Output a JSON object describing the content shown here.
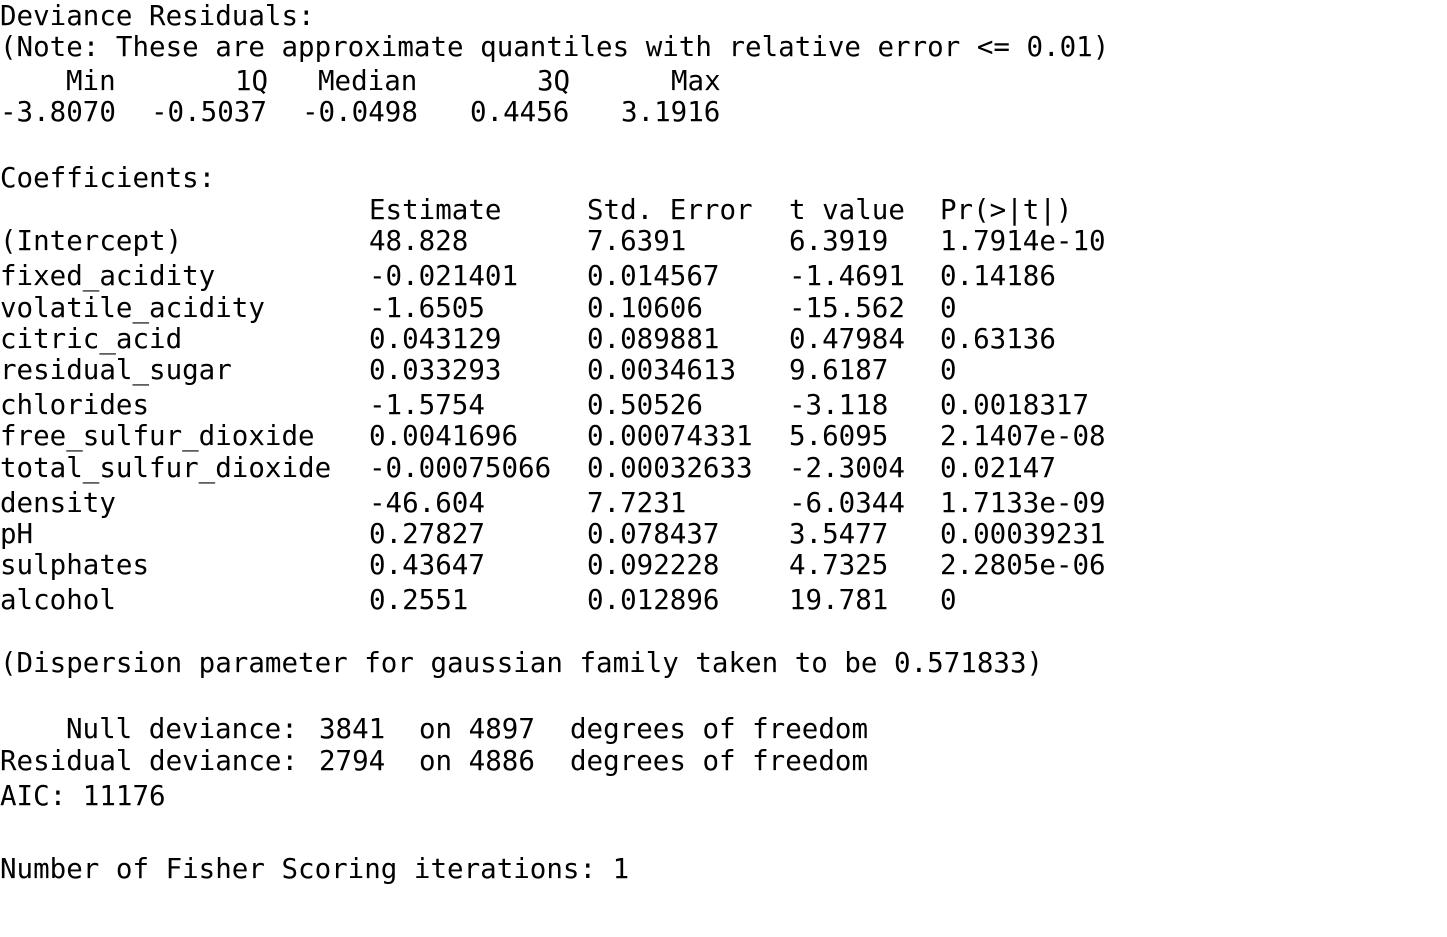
{
  "deviance_residuals": {
    "title": "Deviance Residuals:",
    "note": "(Note: These are approximate quantiles with relative error <= 0.01)",
    "headers": [
      "Min",
      "1Q",
      "Median",
      "3Q",
      "Max"
    ],
    "values": [
      "-3.8070",
      "-0.5037",
      "-0.0498",
      "0.4456",
      "3.1916"
    ]
  },
  "coefficients": {
    "title": "Coefficients:",
    "headers": [
      "Estimate",
      "Std. Error",
      "t value",
      "Pr(>|t|)"
    ],
    "rows": [
      {
        "name": "(Intercept)",
        "estimate": "48.828",
        "std_error": "7.6391",
        "t_value": "6.3919",
        "p_value": "1.7914e-10"
      },
      {
        "name": "fixed_acidity",
        "estimate": "-0.021401",
        "std_error": "0.014567",
        "t_value": "-1.4691",
        "p_value": "0.14186"
      },
      {
        "name": "volatile_acidity",
        "estimate": "-1.6505",
        "std_error": "0.10606",
        "t_value": "-15.562",
        "p_value": "0"
      },
      {
        "name": "citric_acid",
        "estimate": "0.043129",
        "std_error": "0.089881",
        "t_value": "0.47984",
        "p_value": "0.63136"
      },
      {
        "name": "residual_sugar",
        "estimate": "0.033293",
        "std_error": "0.0034613",
        "t_value": "9.6187",
        "p_value": "0"
      },
      {
        "name": "chlorides",
        "estimate": "-1.5754",
        "std_error": "0.50526",
        "t_value": "-3.118",
        "p_value": "0.0018317"
      },
      {
        "name": "free_sulfur_dioxide",
        "estimate": "0.0041696",
        "std_error": "0.00074331",
        "t_value": "5.6095",
        "p_value": "2.1407e-08"
      },
      {
        "name": "total_sulfur_dioxide",
        "estimate": "-0.00075066",
        "std_error": "0.00032633",
        "t_value": "-2.3004",
        "p_value": "0.02147"
      },
      {
        "name": "density",
        "estimate": "-46.604",
        "std_error": "7.7231",
        "t_value": "-6.0344",
        "p_value": "1.7133e-09"
      },
      {
        "name": "pH",
        "estimate": "0.27827",
        "std_error": "0.078437",
        "t_value": "3.5477",
        "p_value": "0.00039231"
      },
      {
        "name": "sulphates",
        "estimate": "0.43647",
        "std_error": "0.092228",
        "t_value": "4.7325",
        "p_value": "2.2805e-06"
      },
      {
        "name": "alcohol",
        "estimate": "0.2551",
        "std_error": "0.012896",
        "t_value": "19.781",
        "p_value": "0"
      }
    ]
  },
  "dispersion": "(Dispersion parameter for gaussian family taken to be 0.571833)",
  "null_deviance": {
    "label": "Null deviance:",
    "value": "3841",
    "df_text": "on 4897",
    "suffix": "degrees of freedom"
  },
  "residual_deviance": {
    "label": "Residual deviance:",
    "value": "2794",
    "df_text": "on 4886",
    "suffix": "degrees of freedom"
  },
  "aic": "AIC: 11176",
  "fisher_iterations": "Number of Fisher Scoring iterations: 1"
}
